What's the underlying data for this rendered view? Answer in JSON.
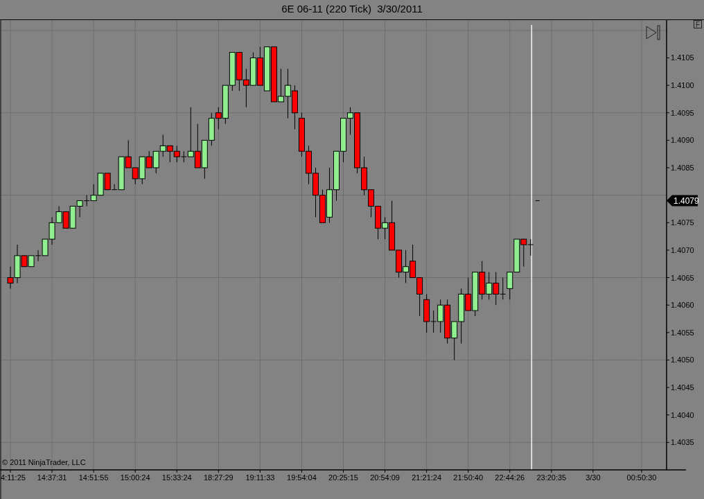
{
  "window": {
    "title": "6E 06-11 (220 Tick)  3/30/2011"
  },
  "toolbar": {
    "toggle_label": "F"
  },
  "copyright": "© 2011 NinjaTrader, LLC",
  "chart": {
    "last_price_label": "1.4079",
    "chart_data": {
      "type": "candlestick",
      "categories": [
        "4:11:25",
        null,
        null,
        null,
        null,
        null,
        "14:37:31",
        null,
        null,
        null,
        null,
        null,
        "14:51:55",
        null,
        null,
        null,
        null,
        null,
        "15:00:24",
        null,
        null,
        null,
        null,
        null,
        "15:33:24",
        null,
        null,
        null,
        null,
        null,
        "18:27:29",
        null,
        null,
        null,
        null,
        null,
        "19:11:33",
        null,
        null,
        null,
        null,
        null,
        "19:54:04",
        null,
        null,
        null,
        null,
        null,
        "20:25:15",
        null,
        null,
        null,
        null,
        null,
        "20:54:09",
        null,
        null,
        null,
        null,
        null,
        "21:21:24",
        null,
        null,
        null,
        null,
        null,
        "21:50:40",
        null,
        null,
        null,
        null,
        null,
        "22:44:26",
        null,
        null,
        null,
        null,
        null,
        "23:20:35",
        null,
        null,
        null,
        null,
        null,
        "3/30",
        null,
        null,
        null,
        null,
        null,
        null,
        "00:50:30"
      ],
      "ohlc": [
        [
          1.4065,
          1.4067,
          1.4063,
          1.4064
        ],
        [
          1.4065,
          1.4071,
          1.4064,
          1.4069
        ],
        [
          1.4069,
          1.4069,
          1.4067,
          1.4067
        ],
        [
          1.4067,
          1.4069,
          1.4067,
          1.4069
        ],
        [
          1.4069,
          1.407,
          1.4068,
          1.4069
        ],
        [
          1.4069,
          1.4072,
          1.4069,
          1.4072
        ],
        [
          1.4072,
          1.4076,
          1.4071,
          1.4075
        ],
        [
          1.4075,
          1.4078,
          1.4075,
          1.4077
        ],
        [
          1.4077,
          1.4077,
          1.4074,
          1.4074
        ],
        [
          1.4074,
          1.4078,
          1.4074,
          1.4078
        ],
        [
          1.4078,
          1.4079,
          1.4076,
          1.4079
        ],
        [
          1.4079,
          1.408,
          1.4078,
          1.4079
        ],
        [
          1.4079,
          1.4082,
          1.4079,
          1.408
        ],
        [
          1.408,
          1.4084,
          1.408,
          1.4084
        ],
        [
          1.4084,
          1.4084,
          1.4081,
          1.4081
        ],
        [
          1.4081,
          1.4082,
          1.4081,
          1.4081
        ],
        [
          1.4081,
          1.4087,
          1.4081,
          1.4087
        ],
        [
          1.4087,
          1.409,
          1.4085,
          1.4085
        ],
        [
          1.4085,
          1.4085,
          1.4082,
          1.4083
        ],
        [
          1.4083,
          1.4087,
          1.4082,
          1.4087
        ],
        [
          1.4087,
          1.4088,
          1.4085,
          1.4085
        ],
        [
          1.4085,
          1.4088,
          1.4084,
          1.4088
        ],
        [
          1.4088,
          1.4091,
          1.4087,
          1.4089
        ],
        [
          1.4089,
          1.4089,
          1.4086,
          1.4088
        ],
        [
          1.4088,
          1.4089,
          1.4086,
          1.4087
        ],
        [
          1.4087,
          1.4088,
          1.4086,
          1.4087
        ],
        [
          1.4087,
          1.4096,
          1.4087,
          1.4088
        ],
        [
          1.4088,
          1.4093,
          1.4085,
          1.4085
        ],
        [
          1.4085,
          1.409,
          1.4083,
          1.409
        ],
        [
          1.409,
          1.4095,
          1.4089,
          1.4094
        ],
        [
          1.4095,
          1.4096,
          1.4092,
          1.4094
        ],
        [
          1.4094,
          1.41,
          1.4093,
          1.41
        ],
        [
          1.41,
          1.4106,
          1.4099,
          1.4106
        ],
        [
          1.4106,
          1.4106,
          1.4099,
          1.4101
        ],
        [
          1.4101,
          1.4103,
          1.4096,
          1.41
        ],
        [
          1.41,
          1.4106,
          1.41,
          1.4105
        ],
        [
          1.4105,
          1.4107,
          1.41,
          1.41
        ],
        [
          1.4099,
          1.4107,
          1.4099,
          1.4107
        ],
        [
          1.4107,
          1.4107,
          1.4097,
          1.4097
        ],
        [
          1.4097,
          1.4103,
          1.4097,
          1.4098
        ],
        [
          1.4098,
          1.4103,
          1.4094,
          1.41
        ],
        [
          1.4099,
          1.41,
          1.4092,
          1.4095
        ],
        [
          1.4094,
          1.4095,
          1.4087,
          1.4088
        ],
        [
          1.4088,
          1.4089,
          1.4082,
          1.4084
        ],
        [
          1.4084,
          1.4085,
          1.4076,
          1.408
        ],
        [
          1.408,
          1.4081,
          1.4075,
          1.4075
        ],
        [
          1.4076,
          1.4085,
          1.4075,
          1.4081
        ],
        [
          1.4081,
          1.4088,
          1.4079,
          1.4088
        ],
        [
          1.4088,
          1.4094,
          1.4086,
          1.4094
        ],
        [
          1.4094,
          1.4096,
          1.4091,
          1.4095
        ],
        [
          1.4095,
          1.4095,
          1.4084,
          1.4085
        ],
        [
          1.4085,
          1.4087,
          1.408,
          1.4081
        ],
        [
          1.4081,
          1.4081,
          1.4076,
          1.4078
        ],
        [
          1.4078,
          1.4078,
          1.4072,
          1.4074
        ],
        [
          1.4074,
          1.4076,
          1.4072,
          1.4075
        ],
        [
          1.4075,
          1.4079,
          1.407,
          1.407
        ],
        [
          1.407,
          1.407,
          1.4065,
          1.4066
        ],
        [
          1.4066,
          1.407,
          1.4064,
          1.4067
        ],
        [
          1.4068,
          1.4071,
          1.4065,
          1.4065
        ],
        [
          1.4065,
          1.4065,
          1.4058,
          1.4062
        ],
        [
          1.4061,
          1.4062,
          1.4055,
          1.4057
        ],
        [
          1.4057,
          1.4059,
          1.4055,
          1.4057
        ],
        [
          1.4057,
          1.4061,
          1.4055,
          1.406
        ],
        [
          1.406,
          1.4061,
          1.4053,
          1.4054
        ],
        [
          1.4054,
          1.4057,
          1.405,
          1.4057
        ],
        [
          1.4057,
          1.4063,
          1.4053,
          1.4062
        ],
        [
          1.4062,
          1.4065,
          1.4059,
          1.4059
        ],
        [
          1.4059,
          1.4066,
          1.4058,
          1.4066
        ],
        [
          1.4066,
          1.4068,
          1.4061,
          1.4062
        ],
        [
          1.4062,
          1.4066,
          1.4061,
          1.4064
        ],
        [
          1.4064,
          1.4066,
          1.406,
          1.4062
        ],
        [
          1.4062,
          1.4065,
          1.4061,
          1.4062
        ],
        [
          1.4063,
          1.4066,
          1.4061,
          1.4066
        ],
        [
          1.4066,
          1.4072,
          1.4066,
          1.4072
        ],
        [
          1.4072,
          1.4072,
          1.4067,
          1.4071
        ],
        [
          1.4071,
          1.4072,
          1.4069,
          1.4071
        ],
        null,
        null,
        null,
        null,
        null,
        null,
        null,
        null,
        null,
        null,
        null,
        null,
        null,
        null,
        null,
        null
      ],
      "ylim": [
        1.403,
        1.4112
      ],
      "grid": true,
      "yticks": [
        {
          "value": 1.4035,
          "label": "1.4035"
        },
        {
          "value": 1.404,
          "label": "1.4040"
        },
        {
          "value": 1.4045,
          "label": "1.4045"
        },
        {
          "value": 1.405,
          "label": "1.4050"
        },
        {
          "value": 1.4055,
          "label": "1.4055"
        },
        {
          "value": 1.406,
          "label": "1.4060"
        },
        {
          "value": 1.4065,
          "label": "1.4065"
        },
        {
          "value": 1.407,
          "label": "1.4070"
        },
        {
          "value": 1.4075,
          "label": "1.4075"
        },
        {
          "value": 1.4085,
          "label": "1.4085"
        },
        {
          "value": 1.409,
          "label": "1.4090"
        },
        {
          "value": 1.4095,
          "label": "1.4095"
        },
        {
          "value": 1.41,
          "label": "1.4100"
        },
        {
          "value": 1.4105,
          "label": "1.4105"
        }
      ]
    }
  }
}
